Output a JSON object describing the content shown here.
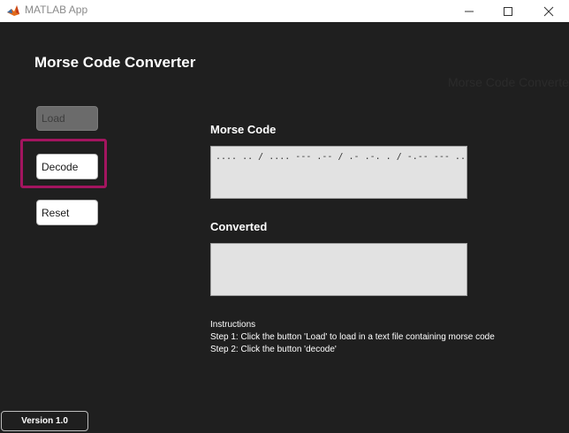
{
  "window": {
    "title": "MATLAB App",
    "controls": {
      "minimize_icon": "minimize-icon",
      "maximize_icon": "maximize-icon",
      "close_icon": "close-icon"
    }
  },
  "header": {
    "title": "Morse Code Converter",
    "ghost_title": "Morse Code Converter"
  },
  "sidebar": {
    "buttons": [
      {
        "label": "Load",
        "state": "disabled"
      },
      {
        "label": "Decode",
        "state": "enabled",
        "highlighted": true
      },
      {
        "label": "Reset",
        "state": "enabled"
      }
    ]
  },
  "fields": {
    "morse": {
      "label": "Morse Code",
      "value": ".... .. / .... --- .-- / .- .-. . / -.-- --- ..- / .---- ..---"
    },
    "converted": {
      "label": "Converted",
      "value": ""
    }
  },
  "instructions": {
    "heading": "Instructions",
    "step1": "Step 1: Click the button 'Load' to load in a text file containing morse code",
    "step2": "Step 2: Click the button 'decode'"
  },
  "footer": {
    "version": "Version 1.0"
  },
  "colors": {
    "background": "#1f1f1f",
    "highlight": "#a3155f",
    "textbox": "#e2e2e2"
  }
}
